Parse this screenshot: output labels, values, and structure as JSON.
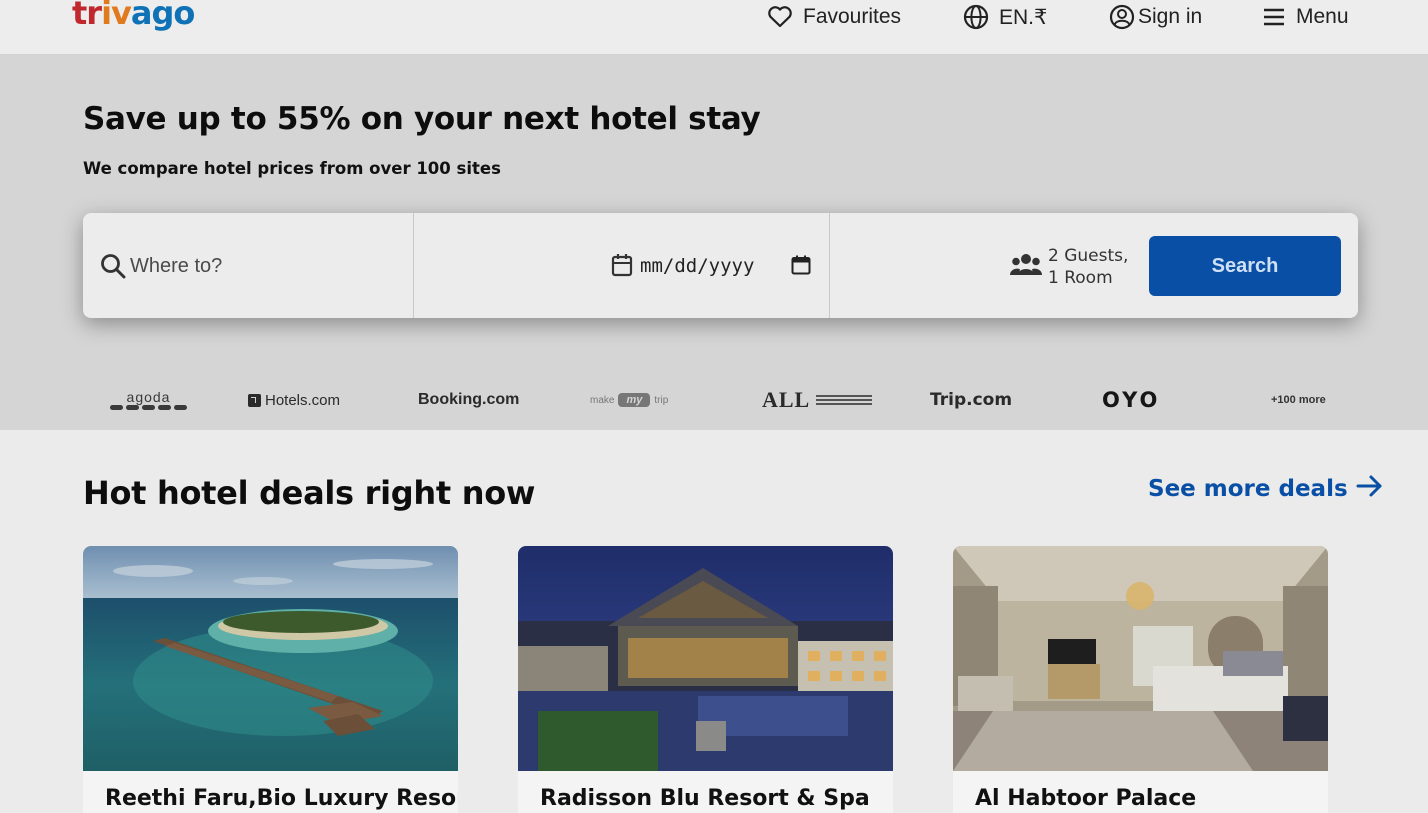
{
  "header": {
    "logo_text": "trivago",
    "nav": {
      "favourites": "Favourites",
      "language": "EN.₹",
      "sign_in": "Sign in",
      "menu": "Menu"
    }
  },
  "hero": {
    "title": "Save up to 55% on your next hotel stay",
    "subtitle": "We compare hotel prices from over 100 sites",
    "search": {
      "destination_placeholder": "Where to?",
      "date_placeholder": "mm/dd/yyyy",
      "guests_line1": "2 Guests,",
      "guests_line2": "1 Room",
      "button_label": "Search"
    },
    "partners": {
      "agoda": "agoda",
      "hotels": "Hotels.com",
      "booking": "Booking.com",
      "makemytrip_make": "make",
      "makemytrip_my": "my",
      "makemytrip_trip": "trip",
      "accor": "ALL",
      "trip": "Trip.com",
      "oyo": "OYO",
      "more": "+100 more"
    }
  },
  "deals": {
    "title": "Hot hotel deals right now",
    "see_more": "See more deals",
    "cards": [
      {
        "name": "Reethi Faru,Bio Luxury Resort"
      },
      {
        "name": "Radisson Blu Resort & Spa"
      },
      {
        "name": "Al Habtoor Palace"
      }
    ]
  },
  "colors": {
    "brand_blue": "#0a4fa6",
    "logo_red": "#c0282d",
    "logo_orange": "#e07a1f",
    "logo_blue": "#0f72b6"
  },
  "icons": [
    "heart-icon",
    "globe-icon",
    "user-circle-icon",
    "menu-icon",
    "search-icon",
    "calendar-icon",
    "guests-icon",
    "arrow-right-icon"
  ]
}
